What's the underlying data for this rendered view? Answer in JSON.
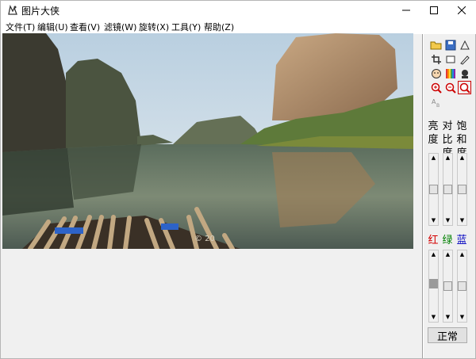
{
  "window": {
    "title": "图片大侠"
  },
  "menu": [
    {
      "label": "文件(T)"
    },
    {
      "label": "编辑(U)"
    },
    {
      "label": "查看(V)"
    },
    {
      "label": "滤镜(W)"
    },
    {
      "label": "旋转(X)"
    },
    {
      "label": "工具(Y)"
    },
    {
      "label": "帮助(Z)"
    }
  ],
  "sliders_top": [
    {
      "label_chars": [
        "亮",
        "度"
      ],
      "level": 0.5
    },
    {
      "label_chars": [
        "对",
        "比",
        "度"
      ],
      "level": 0.5
    },
    {
      "label_chars": [
        "饱",
        "和",
        "度"
      ],
      "level": 0.5
    }
  ],
  "sliders_rgb": [
    {
      "label": "红",
      "color": "#d40000",
      "level": 0.55
    },
    {
      "label": "绿",
      "color": "#008000",
      "level": 0.5
    },
    {
      "label": "蓝",
      "color": "#0000c0",
      "level": 0.5
    }
  ],
  "buttons": {
    "normal": "正常"
  },
  "photo": {
    "watermark": "© 20"
  }
}
